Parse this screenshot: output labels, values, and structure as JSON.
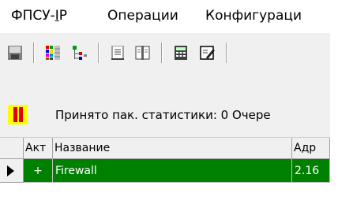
{
  "menu": {
    "items": [
      "ФПСУ-IP",
      "Операции",
      "Конфигураци"
    ]
  },
  "toolbar": {
    "buttons": [
      "save-icon",
      "color-grid-icon",
      "tree-icon",
      "book-icon",
      "book-pages-icon",
      "calculator-icon",
      "edit-document-icon"
    ]
  },
  "status": {
    "text": "Принято пак. статистики: 0 Очере",
    "pause_colors": {
      "bg": "#ffff00",
      "bars": "#e00000"
    }
  },
  "grid": {
    "headers": [
      "Акт",
      "Название",
      "Адр"
    ],
    "rows": [
      {
        "active": "+",
        "name": "Firewall",
        "address": "2.16"
      }
    ],
    "selection_color": "#008000"
  }
}
